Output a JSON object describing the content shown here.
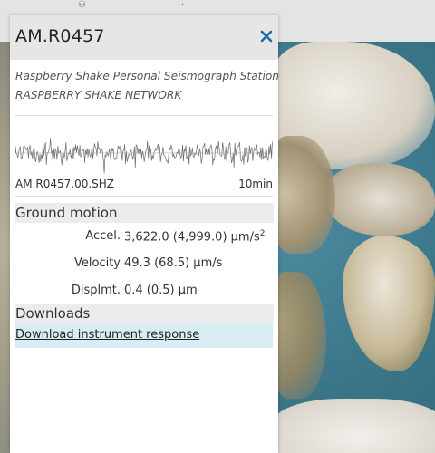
{
  "station": {
    "title": "AM.R0457",
    "description": "Raspberry Shake Personal Seismograph Station",
    "network": "RASPBERRY SHAKE NETWORK",
    "channel": "AM.R0457.00.SHZ",
    "window": "10min"
  },
  "ground_motion": {
    "heading": "Ground motion",
    "rows": [
      {
        "label": "Accel.",
        "value": "3,622.0 (4,999.0) µm/s",
        "sup": "2"
      },
      {
        "label": "Velocity",
        "value": "49.3 (68.5) µm/s",
        "sup": ""
      },
      {
        "label": "Displmt.",
        "value": "0.4 (0.5) µm",
        "sup": ""
      }
    ]
  },
  "downloads": {
    "heading": "Downloads",
    "link_label": "Download instrument response"
  },
  "icons": {
    "close": "close-icon"
  },
  "colors": {
    "close_icon": "#1b6aa5",
    "download_bg": "#d8eef2",
    "trace": "#6b6b6b"
  }
}
